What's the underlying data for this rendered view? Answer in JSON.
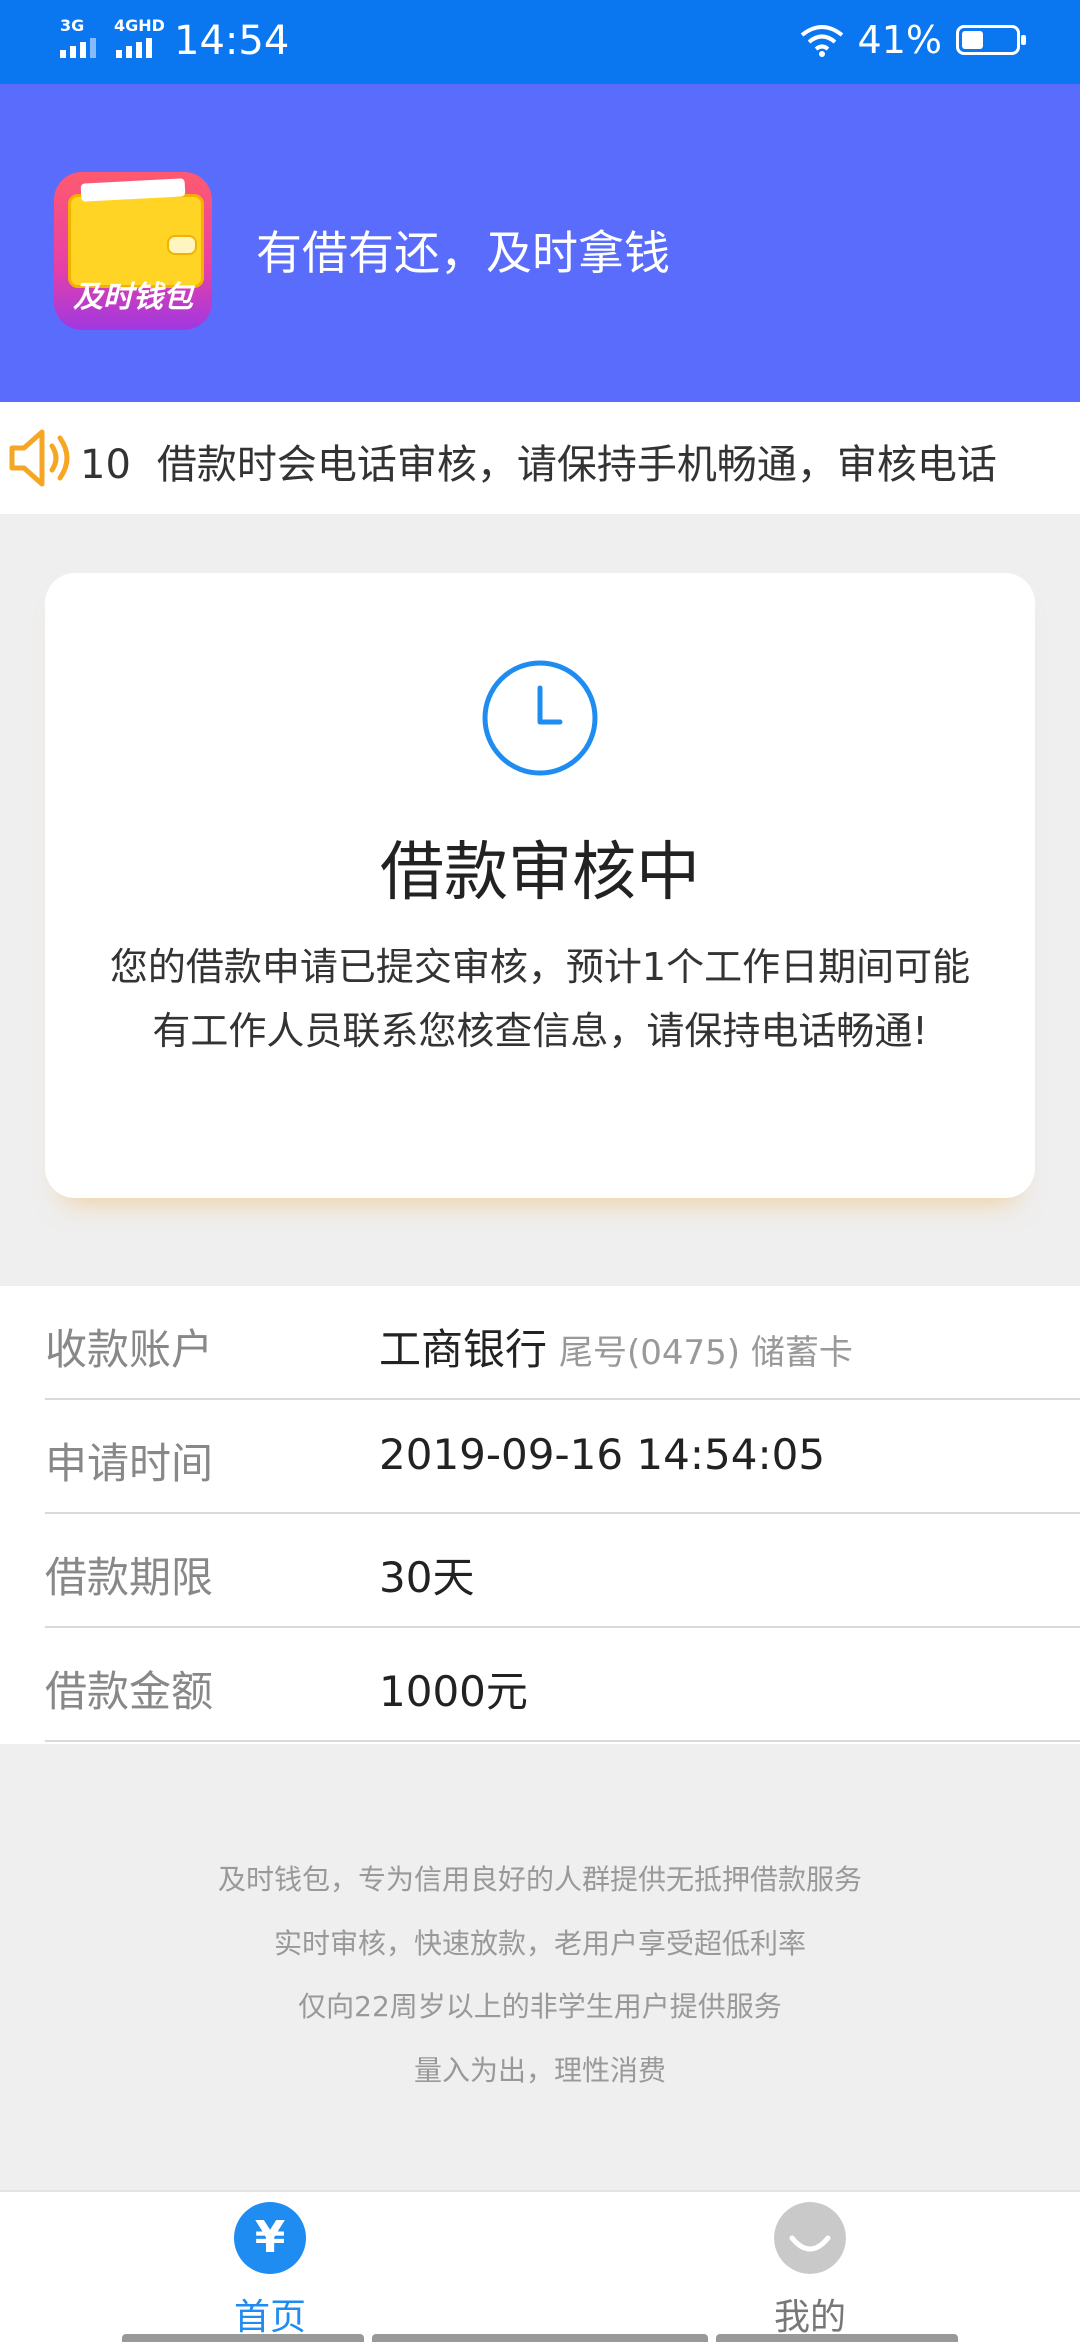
{
  "status_bar": {
    "network_1": "3G",
    "network_2": "4GHD",
    "time": "14:54",
    "battery_percent": "41%",
    "battery_level": 0.41
  },
  "header": {
    "logo_text": "及时钱包",
    "slogan": "有借有还，及时拿钱"
  },
  "notice": {
    "count": "10",
    "message": "借款时会电话审核，请保持手机畅通，审核电话"
  },
  "status_card": {
    "title": "借款审核中",
    "description": "您的借款申请已提交审核，预计1个工作日期间可能有工作人员联系您核查信息，请保持电话畅通!"
  },
  "info": {
    "account": {
      "label": "收款账户",
      "bank": "工商银行",
      "detail": "尾号(0475) 储蓄卡"
    },
    "apply_time": {
      "label": "申请时间",
      "value": "2019-09-16 14:54:05"
    },
    "term": {
      "label": "借款期限",
      "value": "30天"
    },
    "amount": {
      "label": "借款金额",
      "value": "1000元"
    }
  },
  "footer": {
    "lines": [
      "及时钱包，专为信用良好的人群提供无抵押借款服务",
      "实时审核，快速放款，老用户享受超低利率",
      "仅向22周岁以上的非学生用户提供服务",
      "量入为出，理性消费"
    ]
  },
  "tabbar": {
    "home": {
      "label": "首页",
      "icon_glyph": "¥"
    },
    "mine": {
      "label": "我的"
    }
  },
  "colors": {
    "status_bar": "#0a76f0",
    "header": "#5a6cfb",
    "accent_blue": "#1e8cf0",
    "speaker_orange": "#f5a623"
  },
  "icons": [
    "signal-icon",
    "wifi-icon",
    "battery-icon",
    "speaker-icon",
    "clock-icon",
    "yuan-icon",
    "profile-icon"
  ]
}
